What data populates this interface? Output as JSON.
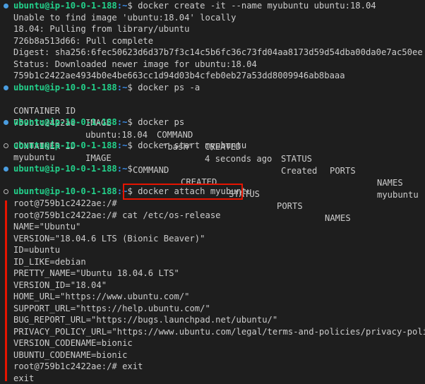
{
  "prompt": {
    "user_host": "ubuntu@ip-10-0-1-188",
    "path": ":~",
    "symbol": "$"
  },
  "commands": {
    "create": "docker create -it --name myubuntu ubuntu:18.04",
    "ps_a": "docker ps -a",
    "ps": "docker ps",
    "start": "docker start myubuntu",
    "empty": "",
    "attach": "docker attach myubuntu"
  },
  "create_output": [
    "Unable to find image 'ubuntu:18.04' locally",
    "18.04: Pulling from library/ubuntu",
    "726b8a513d66: Pull complete",
    "Digest: sha256:6fec50623d6d37b7f3c14c5b6fc36c73fd04aa8173d59d54dba00da0e7ac50ee",
    "Status: Downloaded newer image for ubuntu:18.04",
    "759b1c2422ae4934b0e4be663cc1d94d03b4cfeb0eb27a53dd8009946ab8baaa"
  ],
  "ps_a_table": {
    "headers": [
      "CONTAINER ID",
      "IMAGE",
      "COMMAND",
      "CREATED",
      "STATUS",
      "PORTS",
      "NAMES"
    ],
    "row": [
      "759b1c2422ae",
      "ubuntu:18.04",
      "\"bash\"",
      "4 seconds ago",
      "Created",
      "",
      "myubuntu"
    ]
  },
  "ps_table": {
    "headers": [
      "CONTAINER ID",
      "IMAGE",
      "COMMAND",
      "CREATED",
      "STATUS",
      "PORTS",
      "NAMES"
    ]
  },
  "start_output": "myubuntu",
  "container_session": [
    "root@759b1c2422ae:/#",
    "root@759b1c2422ae:/# cat /etc/os-release",
    "NAME=\"Ubuntu\"",
    "VERSION=\"18.04.6 LTS (Bionic Beaver)\"",
    "ID=ubuntu",
    "ID_LIKE=debian",
    "PRETTY_NAME=\"Ubuntu 18.04.6 LTS\"",
    "VERSION_ID=\"18.04\"",
    "HOME_URL=\"https://www.ubuntu.com/\"",
    "SUPPORT_URL=\"https://help.ubuntu.com/\"",
    "BUG_REPORT_URL=\"https://bugs.launchpad.net/ubuntu/\"",
    "PRIVACY_POLICY_URL=\"https://www.ubuntu.com/legal/terms-and-policies/privacy-policy\"",
    "VERSION_CODENAME=bionic",
    "UBUNTU_CODENAME=bionic",
    "root@759b1c2422ae:/# exit",
    "exit"
  ],
  "colors": {
    "background": "#1e1e1e",
    "text": "#cccccc",
    "prompt": "#23d18b",
    "path": "#3b8eea",
    "highlight": "#e51400",
    "decoration_success": "#4a9de0"
  }
}
